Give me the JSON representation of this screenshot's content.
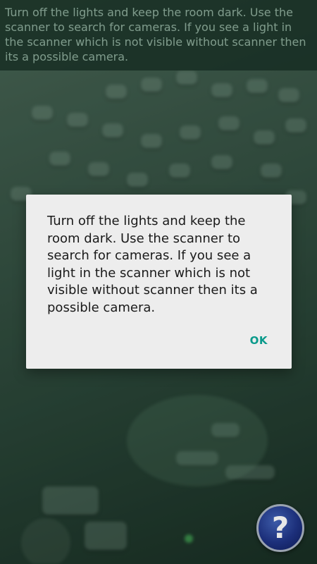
{
  "top_hint": {
    "text": "Turn off the lights and keep the room dark. Use the scanner to search for cameras. If you see a light in the scanner which is not visible without scanner then its a possible camera."
  },
  "dialog": {
    "message": "Turn off the lights and keep the room dark. Use the scanner to search for cameras. If you see a light in the scanner which is not visible without scanner then its a possible camera.",
    "ok_label": "OK"
  },
  "help_button": {
    "glyph": "?"
  },
  "colors": {
    "accent": "#0a9a8b",
    "help_button": "#1c2f7a",
    "tint": "#3c5b4b"
  }
}
